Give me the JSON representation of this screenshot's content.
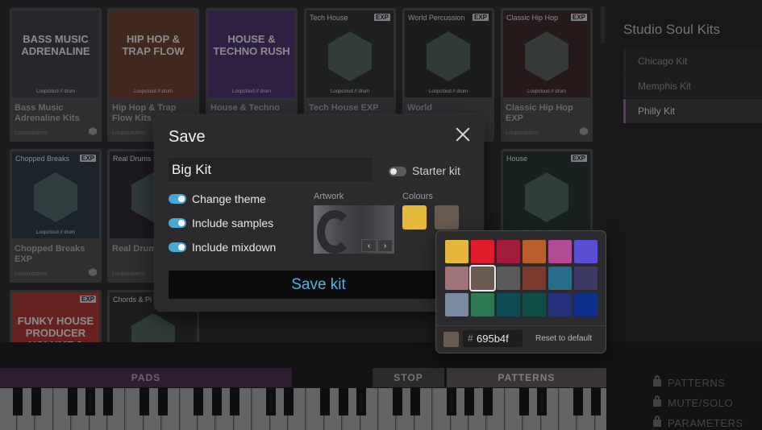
{
  "kits": {
    "row1": [
      {
        "tag": "",
        "art_text": "BASS MUSIC ADRENALINE",
        "title": "Bass Music Adrenaline Kits",
        "maker": "Loopmasters",
        "lc": "Loopcloud // drum",
        "bg": "#3b3d40"
      },
      {
        "tag": "",
        "art_text": "HIP HOP & TRAP FLOW",
        "title": "Hip Hop & Trap Flow Kits",
        "maker": "Loopmasters",
        "lc": "Loopcloud // drum",
        "bg": "#6b3d2c"
      },
      {
        "tag": "",
        "art_text": "HOUSE & TECHNO RUSH",
        "title": "House & Techno Rush Kits",
        "maker": "",
        "lc": "Loopcloud // drum",
        "bg": "#4a2f6a"
      },
      {
        "tag": "Tech House",
        "exp": "EXP",
        "title": "Tech House EXP",
        "maker": "",
        "lc": "Loopcloud // drum",
        "bg": "#2d2f31"
      },
      {
        "tag": "World Percussion",
        "exp": "EXP",
        "title": "World",
        "maker": "",
        "lc": "Loopcloud // drum",
        "bg": "#2b2a28"
      },
      {
        "tag": "Classic Hip Hop",
        "exp": "EXP",
        "title": "Classic Hip Hop EXP",
        "maker": "Loopmasters",
        "lc": "Loopcloud // drum",
        "bg": "#3a2523"
      }
    ],
    "row2": [
      {
        "tag": "Chopped Breaks",
        "exp": "EXP",
        "title": "Chopped Breaks EXP",
        "maker": "Loopmasters",
        "lc": "Loopcloud // drum",
        "bg": "#2a3440"
      },
      {
        "tag": "Real Drums",
        "exp": "",
        "title": "Real Drums",
        "maker": "Loopmasters",
        "lc": "",
        "bg": "#2c2630"
      },
      {
        "tag": "House",
        "exp": "EXP",
        "title": "",
        "maker": "",
        "lc": "Loopcloud // drum",
        "bg": "#253130"
      }
    ],
    "row3": [
      {
        "tag": "",
        "art_text": "FUNKY HOUSE PRODUCER VOLUME 2",
        "exp": "EXP",
        "bg": "#a8352e"
      },
      {
        "tag": "Chords & Pi",
        "bg": "#2c2e2c"
      }
    ]
  },
  "sidebar": {
    "title": "Studio Soul Kits",
    "items": [
      {
        "label": "Chicago Kit"
      },
      {
        "label": "Memphis Kit"
      },
      {
        "label": "Philly Kit"
      }
    ]
  },
  "transport": {
    "pads": "PADS",
    "stop": "STOP",
    "patterns": "PATTERNS"
  },
  "locks": {
    "patterns": "PATTERNS",
    "mute_solo": "MUTE/SOLO",
    "parameters": "PARAMETERS"
  },
  "dialog": {
    "title": "Save",
    "name_value": "Big Kit",
    "starter_kit_label": "Starter kit",
    "starter_kit_on": false,
    "options": [
      {
        "label": "Change theme",
        "on": true
      },
      {
        "label": "Include samples",
        "on": true
      },
      {
        "label": "Include mixdown",
        "on": true
      }
    ],
    "artwork_label": "Artwork",
    "colours_label": "Colours",
    "prev_glyph": "‹",
    "next_glyph": "›",
    "colour_1": "#e4b93c",
    "colour_2": "#695b4f",
    "save_label": "Save kit"
  },
  "picker": {
    "colors": [
      "#e3b83c",
      "#e01b2c",
      "#a31c3c",
      "#b85f2c",
      "#b24a96",
      "#5a4fd2",
      "#a1747c",
      "#695b4f",
      "#5a5a5a",
      "#7a3a2e",
      "#2a6b88",
      "#3d3a66",
      "#7a8aa0",
      "#2d7a52",
      "#0f4a55",
      "#0f4d46",
      "#25307a",
      "#0e2f8a"
    ],
    "selected_index": 7,
    "hash": "#",
    "hex_value": "695b4f",
    "reset_label": "Reset to default"
  }
}
